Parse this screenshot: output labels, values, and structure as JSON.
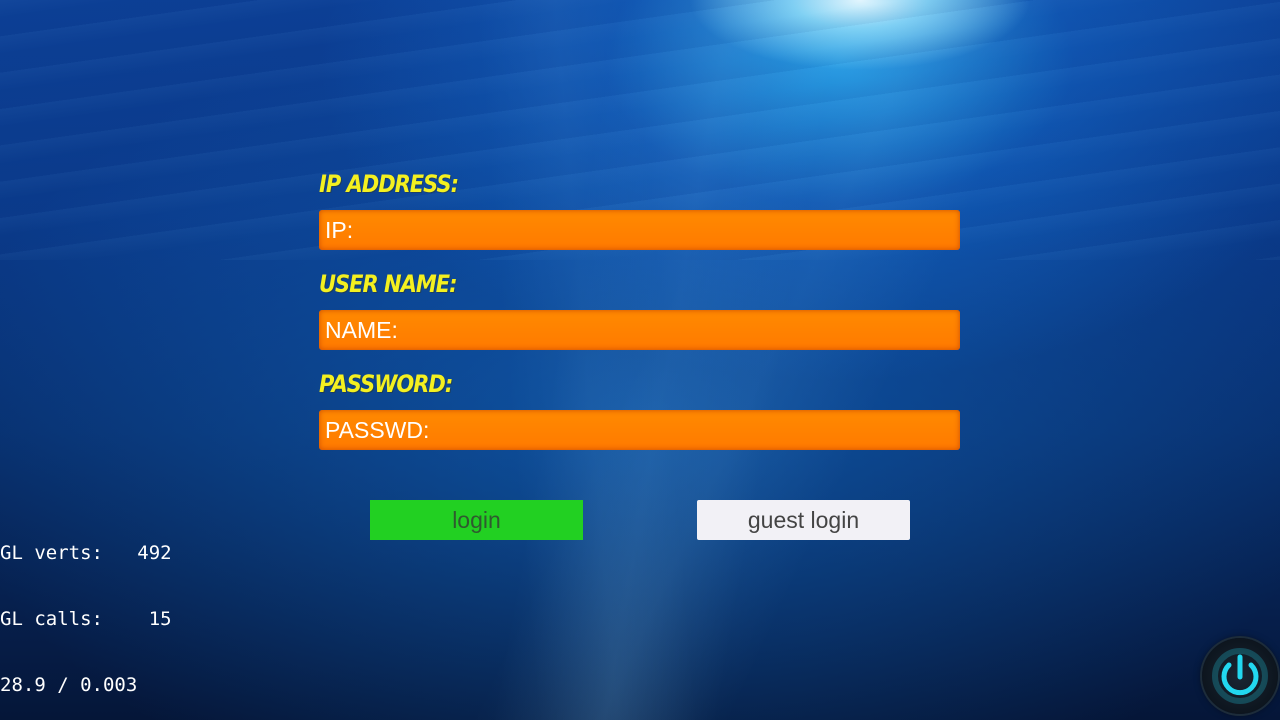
{
  "form": {
    "ip": {
      "label": "IP ADDRESS:",
      "placeholder": "IP:",
      "value": ""
    },
    "user": {
      "label": "USER NAME:",
      "placeholder": "NAME:",
      "value": ""
    },
    "password": {
      "label": "PASSWORD:",
      "placeholder": "PASSWD:",
      "value": ""
    }
  },
  "buttons": {
    "login": "login",
    "guest_login": "guest login"
  },
  "debug": {
    "line1": "GL verts:   492",
    "line2": "GL calls:    15",
    "line3": "28.9 / 0.003"
  },
  "icons": {
    "power": "power-icon"
  },
  "colors": {
    "label": "#f4f020",
    "input_bg": "#ff8000",
    "login_bg": "#22d022",
    "guest_bg": "#f2f1f6",
    "power_glow": "#22d8f0"
  }
}
